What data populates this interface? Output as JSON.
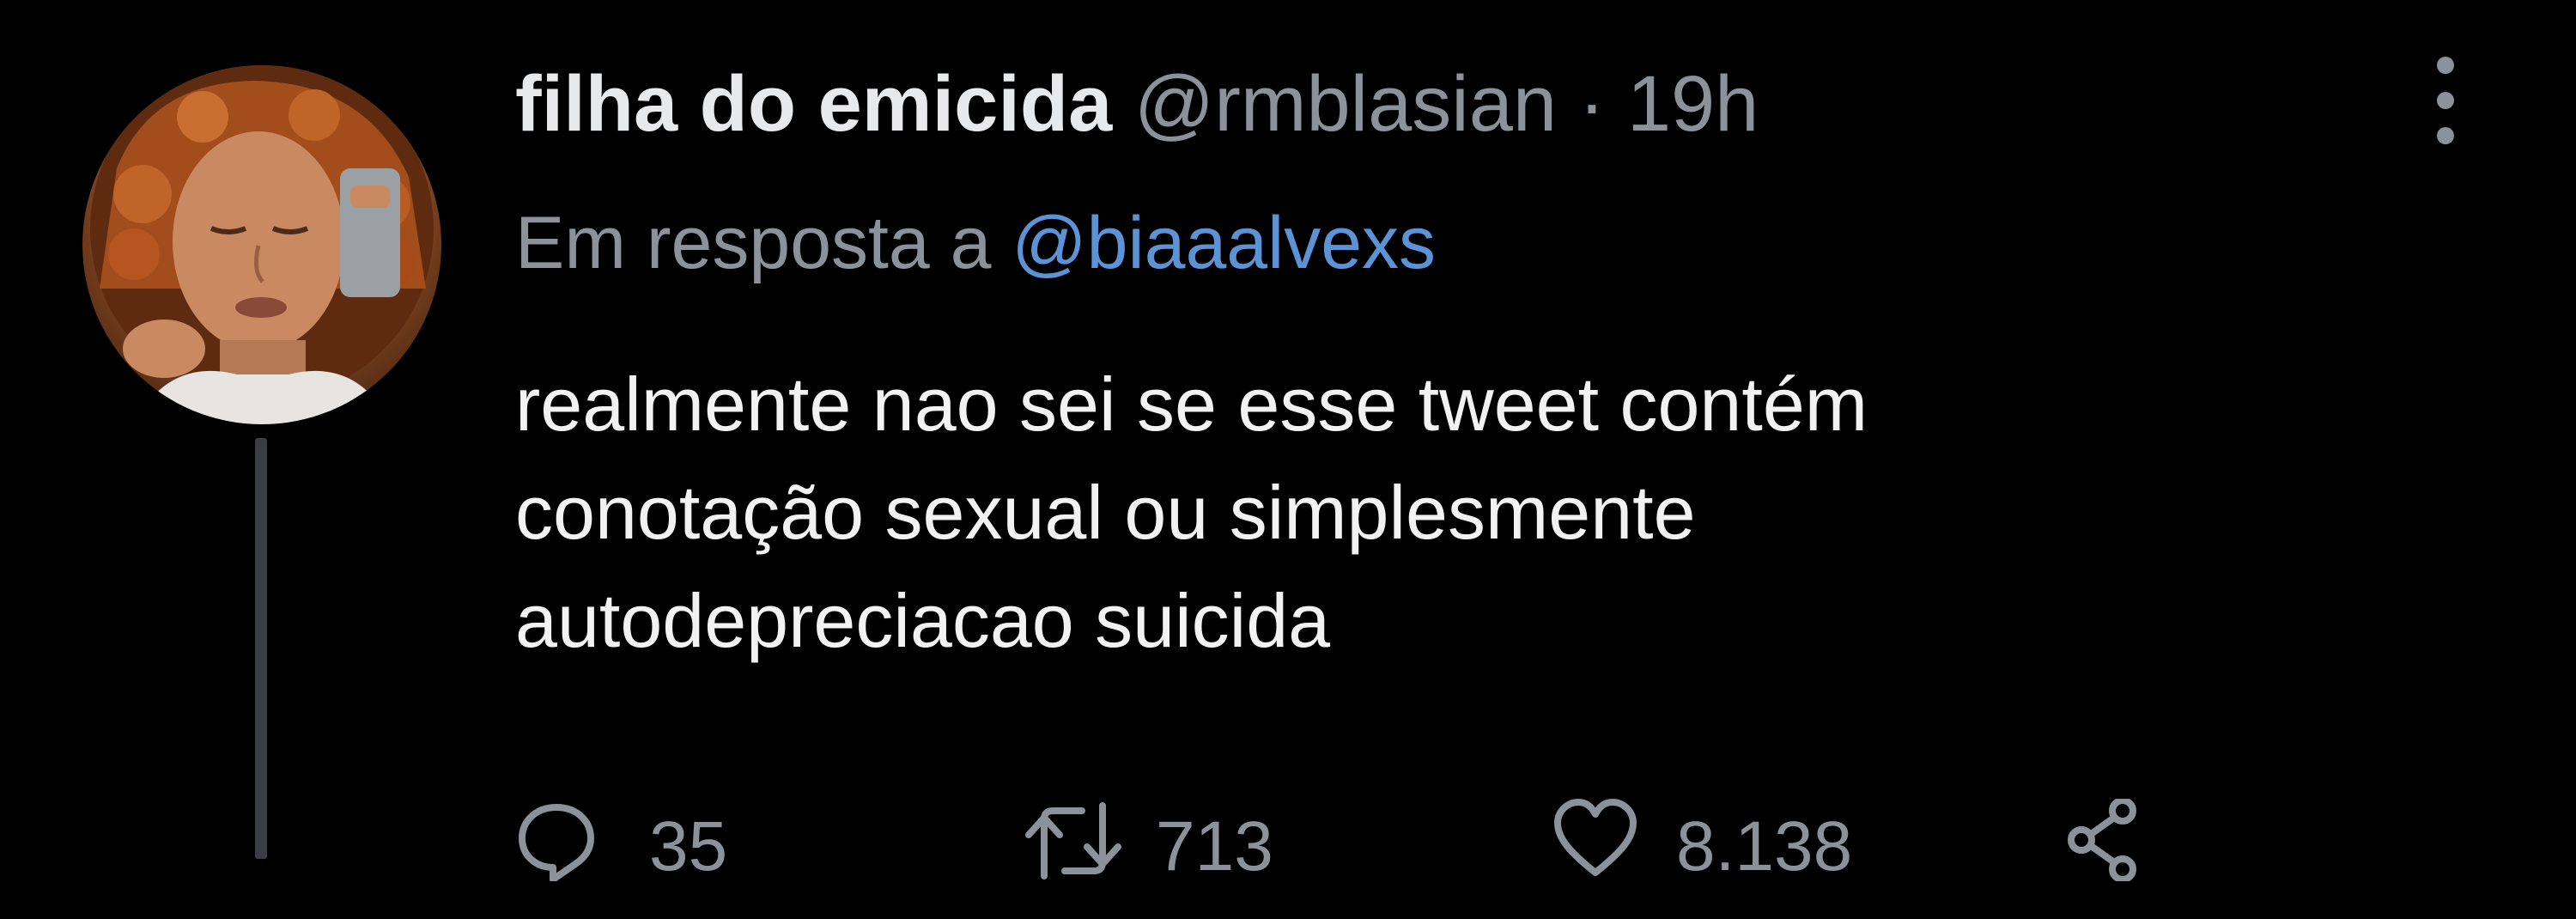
{
  "tweet": {
    "author": {
      "display_name": "filha do emicida",
      "handle": "@rmblasian",
      "separator": "·",
      "time": "19h"
    },
    "reply_to": {
      "prefix": "Em resposta a",
      "handle": "@biaaalvexs"
    },
    "body_lines": [
      "realmente nao sei se esse tweet contém",
      "conotação sexual ou simplesmente",
      "autodepreciacao suicida"
    ],
    "actions": {
      "replies": "35",
      "retweets": "713",
      "likes": "8.138"
    }
  },
  "colors": {
    "background": "#000000",
    "primary_text": "#e7e9ea",
    "secondary_text": "#8b9299",
    "link": "#5b93d6"
  },
  "icons": {
    "more": "more-vertical-icon",
    "reply": "reply-icon",
    "retweet": "retweet-icon",
    "like": "heart-icon",
    "share": "share-icon"
  }
}
